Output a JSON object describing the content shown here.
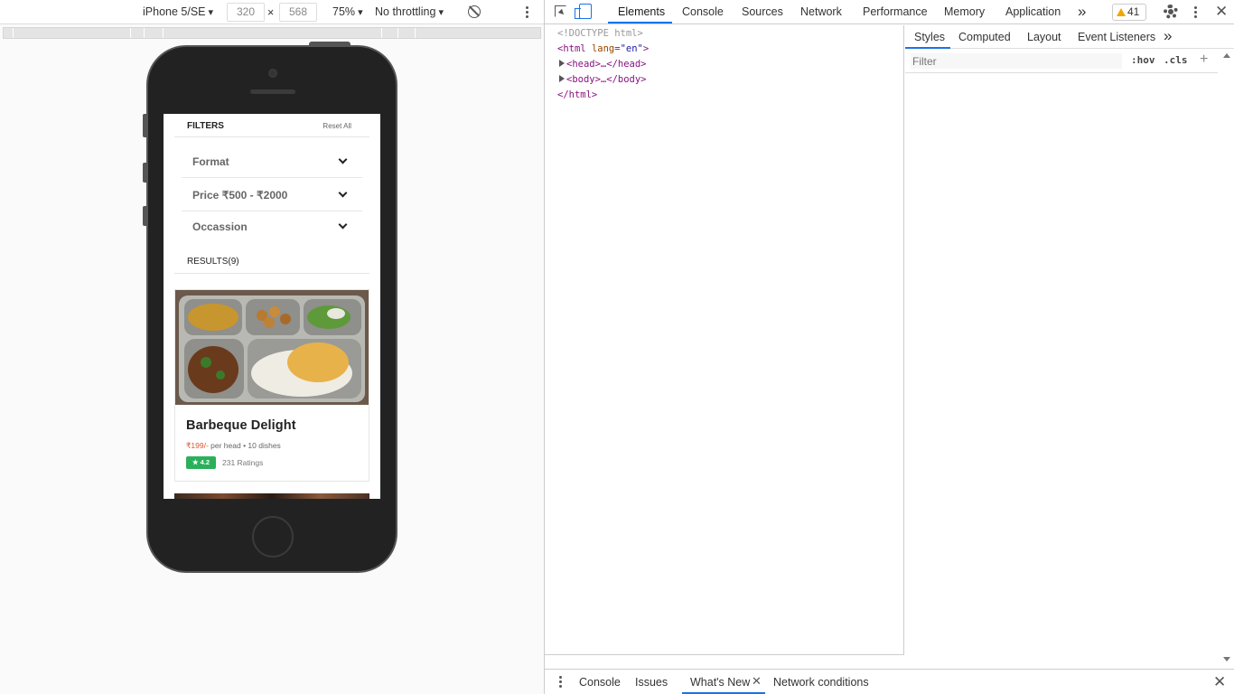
{
  "device_toolbar": {
    "device": "iPhone 5/SE",
    "width": "320",
    "height": "568",
    "times": "×",
    "zoom": "75%",
    "throttling": "No throttling"
  },
  "phone_screen": {
    "filters_title": "FILTERS",
    "reset_all": "Reset All",
    "filters": [
      {
        "label": "Format"
      },
      {
        "label": "Price ₹500 - ₹2000"
      },
      {
        "label": "Occassion"
      }
    ],
    "results_label": "RESULTS(9)",
    "card": {
      "title": "Barbeque Delight",
      "price": "₹199/-",
      "meta": " per head • 10 dishes",
      "rating": "★ 4.2",
      "rating_count": "231 Ratings",
      "colors": {
        "price": "#e0542c",
        "rating_badge": "#2ab05a"
      }
    }
  },
  "devtools": {
    "tabs": [
      "Elements",
      "Console",
      "Sources",
      "Network",
      "Performance",
      "Memory",
      "Application"
    ],
    "active_tab": "Elements",
    "more_tabs": "»",
    "warnings_count": "41",
    "dom": {
      "doctype": "<!DOCTYPE html>",
      "html_open_tag": "html",
      "html_attr_name": "lang",
      "html_attr_value": "\"en\"",
      "head": "<head>…</head>",
      "body": "<body>…</body>",
      "html_close": "</html>"
    },
    "styles_tabs": [
      "Styles",
      "Computed",
      "Layout",
      "Event Listeners"
    ],
    "styles_more": "»",
    "filter_placeholder": "Filter",
    "hov": ":hov",
    "cls": ".cls",
    "drawer_tabs": [
      "Console",
      "Issues",
      "What's New",
      "Network conditions"
    ],
    "drawer_active": "What's New",
    "accent_color": "#1a73e8"
  }
}
